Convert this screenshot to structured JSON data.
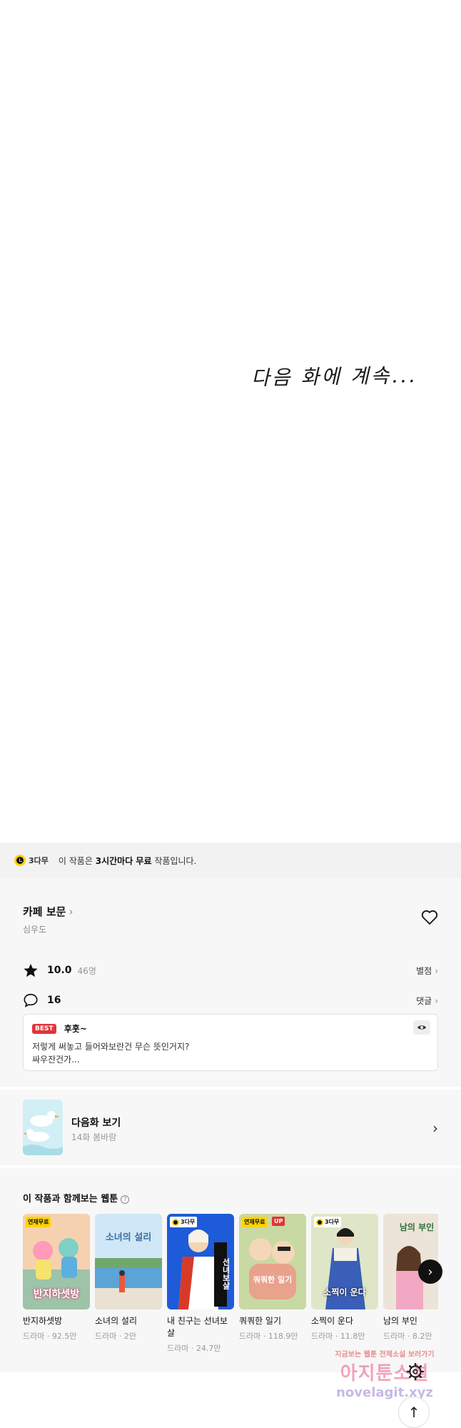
{
  "comic": {
    "end_text": "다음 화에 계속..."
  },
  "free_bar": {
    "badge": "3다무",
    "text_pre": "이 작품은",
    "text_bold": "3시간마다 무료",
    "text_post": "작품입니다."
  },
  "work": {
    "title": "카페 보문",
    "author": "심우도",
    "rating": "10.0",
    "rating_count": "46명",
    "rating_link": "별점",
    "comment_count": "16",
    "comment_link": "댓글"
  },
  "best_comment": {
    "badge": "BEST",
    "user": "후훗~",
    "line1": "저렇게 써놓고 들어와보란건 무슨 뜻인거지?",
    "line2": "싸우잔건가..."
  },
  "next_episode": {
    "title": "다음화 보기",
    "subtitle": "14화 봄바람"
  },
  "recommendations": {
    "title": "이 작품과 함께보는 웹툰",
    "help": "?",
    "items": [
      {
        "name": "반지하셋방",
        "meta": "드라마 · 92.5만",
        "tag": "연재무료",
        "cover": "반지하셋방"
      },
      {
        "name": "소녀의 설리",
        "meta": "드라마 · 2만",
        "tag": "",
        "cover": "소녀의 설리"
      },
      {
        "name": "내 친구는 선녀보살",
        "meta": "드라마 · 24.7만",
        "tag": "3다무",
        "cover": "선녀보살"
      },
      {
        "name": "쿼쿼한 일기",
        "meta": "드라마 · 118.9만",
        "tag": "연재무료",
        "tag2": "UP",
        "cover": "쿼쿼한 일기"
      },
      {
        "name": "소찍이 운다",
        "meta": "드라마 · 11.8만",
        "tag": "3다무",
        "cover": "소찍이 운다"
      },
      {
        "name": "남의 부인",
        "meta": "드라마 · 8.2만",
        "tag": "",
        "cover": "남의 부인"
      }
    ]
  },
  "watermark": {
    "line1": "지금보는 웹툰 전체소설 보러가기",
    "line2": "아지툰소설",
    "line3": "novelagit.xyz"
  },
  "icons": {
    "accent": "#ffd400",
    "best_red": "#e0353b"
  }
}
